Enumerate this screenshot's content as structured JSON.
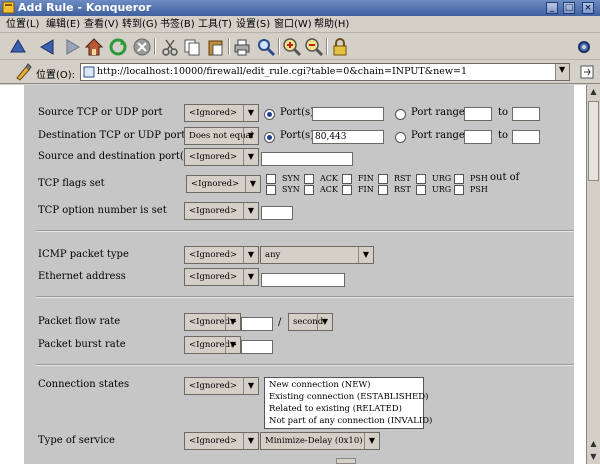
{
  "window": {
    "title": "Add Rule - Konqueror"
  },
  "menu": [
    "位置(L)",
    "编辑(E)",
    "查看(V)",
    "转到(G)",
    "书签(B)",
    "工具(T)",
    "设置(S)",
    "窗口(W)",
    "帮助(H)"
  ],
  "location": {
    "label": "位置(O):",
    "url": "http://localhost:10000/firewall/edit_rule.cgi?table=0&chain=INPUT&new=1"
  },
  "form": {
    "src_port": {
      "label": "Source TCP or UDP port",
      "mode": "<Ignored>",
      "ports_label": "Port(s)",
      "range_label": "Port range",
      "to_label": "to",
      "ports_value": ""
    },
    "dst_port": {
      "label": "Destination TCP or UDP port",
      "mode": "Does not equal",
      "ports_label": "Port(s)",
      "range_label": "Port range",
      "to_label": "to",
      "ports_value": "80,443"
    },
    "src_dst_ports": {
      "label": "Source and destination port(s)",
      "mode": "<Ignored>"
    },
    "tcp_flags": {
      "label": "TCP flags set",
      "mode": "<Ignored>",
      "flags": [
        "SYN",
        "ACK",
        "FIN",
        "RST",
        "URG",
        "PSH"
      ],
      "out_of": "out of"
    },
    "tcp_option": {
      "label": "TCP option number is set",
      "mode": "<Ignored>"
    },
    "icmp": {
      "label": "ICMP packet type",
      "mode": "<Ignored>",
      "value": "any"
    },
    "ethernet": {
      "label": "Ethernet address",
      "mode": "<Ignored>"
    },
    "flow_rate": {
      "label": "Packet flow rate",
      "mode": "<Ignored>",
      "separator": "/",
      "unit": "second"
    },
    "burst_rate": {
      "label": "Packet burst rate",
      "mode": "<Ignored>"
    },
    "conn_states": {
      "label": "Connection states",
      "mode": "<Ignored>",
      "options": [
        "New connection (NEW)",
        "Existing connection (ESTABLISHED)",
        "Related to existing (RELATED)",
        "Not part of any connection (INVALID)"
      ]
    },
    "tos": {
      "label": "Type of service",
      "mode": "<Ignored>",
      "value": "Minimize-Delay (0x10)"
    }
  }
}
